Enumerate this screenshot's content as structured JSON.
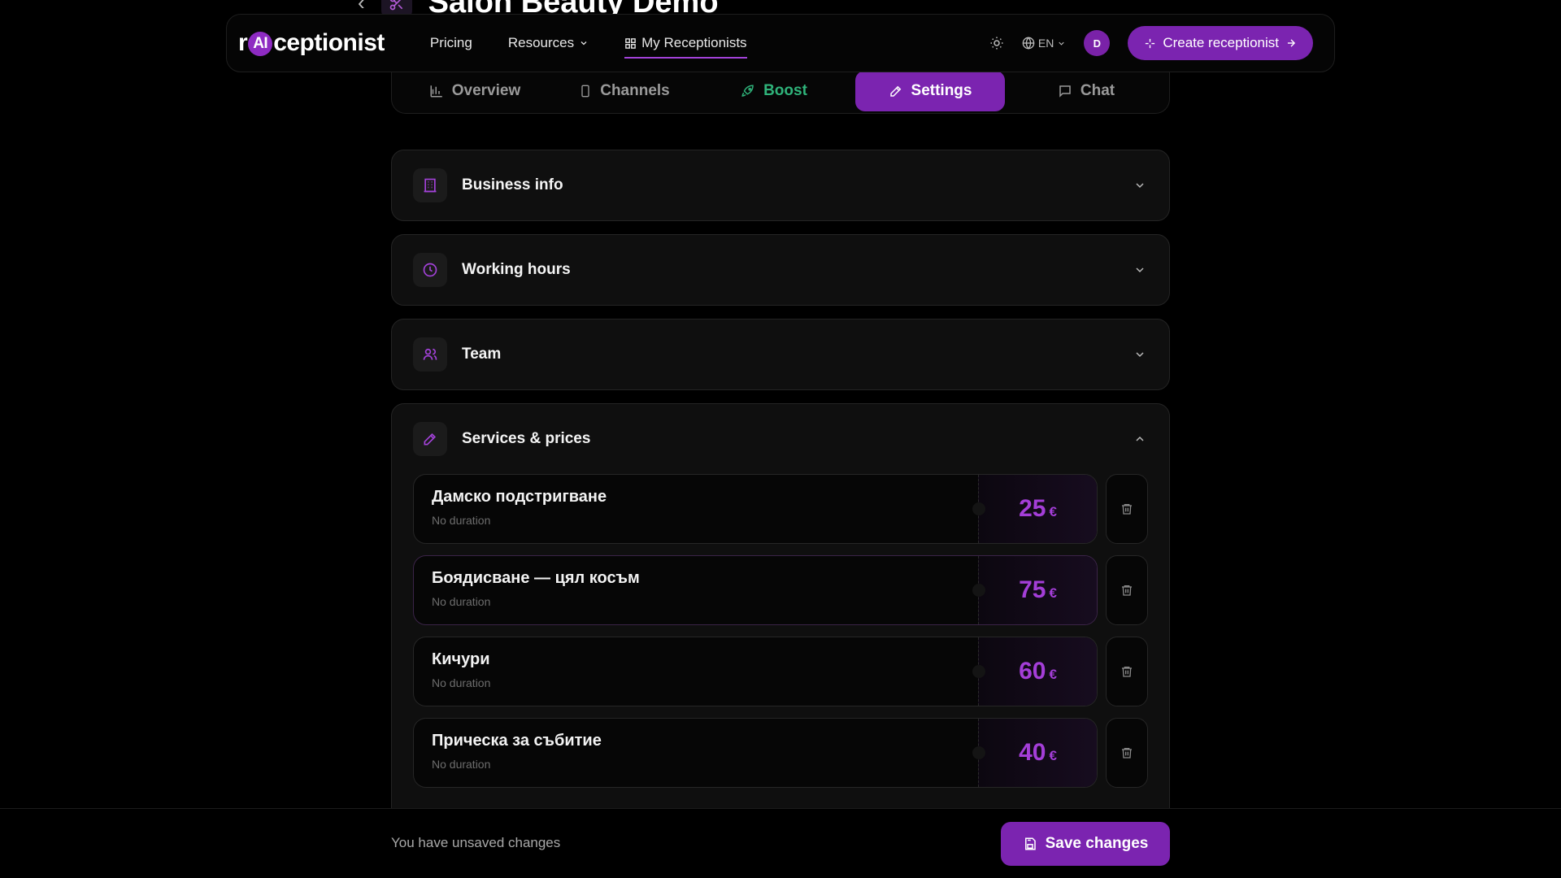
{
  "page": {
    "title": "Salon Beauty Demo"
  },
  "nav": {
    "logo_prefix": "r",
    "logo_ai": "AI",
    "logo_suffix": "ceptionist",
    "links": [
      {
        "label": "Pricing"
      },
      {
        "label": "Resources"
      },
      {
        "label": "My Receptionists",
        "active": true
      }
    ],
    "language": "EN",
    "avatar_initial": "D",
    "create_label": "Create receptionist"
  },
  "tabs": [
    {
      "label": "Overview",
      "icon": "bar-chart-icon"
    },
    {
      "label": "Channels",
      "icon": "phone-icon"
    },
    {
      "label": "Boost",
      "icon": "rocket-icon"
    },
    {
      "label": "Settings",
      "icon": "pencil-icon",
      "active": true
    },
    {
      "label": "Chat",
      "icon": "chat-icon"
    }
  ],
  "sections": {
    "business_info": {
      "title": "Business info",
      "icon": "building-icon"
    },
    "working_hours": {
      "title": "Working hours",
      "icon": "clock-icon"
    },
    "team": {
      "title": "Team",
      "icon": "users-icon"
    },
    "services": {
      "title": "Services & prices",
      "icon": "pencil-icon"
    }
  },
  "services": [
    {
      "name": "Дамско подстригване",
      "duration": "No duration",
      "price": "25",
      "currency": "€"
    },
    {
      "name": "Боядисване — цял косъм",
      "duration": "No duration",
      "price": "75",
      "currency": "€"
    },
    {
      "name": "Кичури",
      "duration": "No duration",
      "price": "60",
      "currency": "€"
    },
    {
      "name": "Прическа за събитие",
      "duration": "No duration",
      "price": "40",
      "currency": "€"
    }
  ],
  "footer": {
    "unsaved_text": "You have unsaved changes",
    "save_label": "Save changes"
  },
  "colors": {
    "accent": "#7b24b0",
    "accent_text": "#a43ed8",
    "boost_green": "#2fb37a",
    "background": "#000000"
  }
}
